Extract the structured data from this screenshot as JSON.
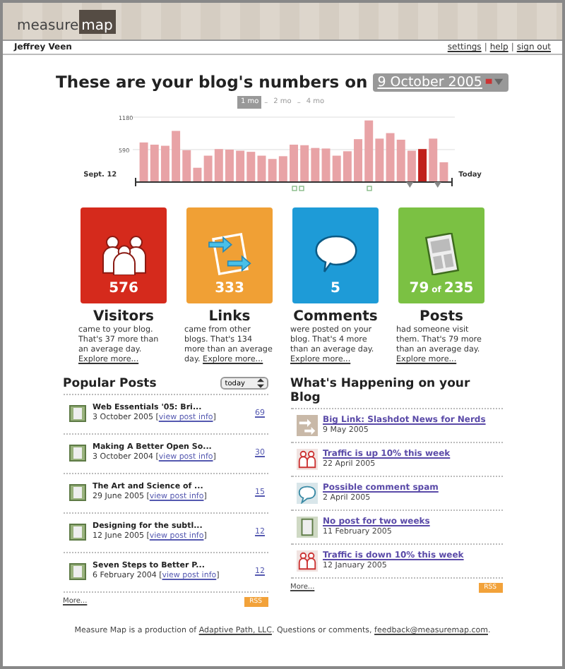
{
  "header": {
    "logo_left": "measure",
    "logo_right": "map"
  },
  "user_bar": {
    "user": "Jeffrey Veen",
    "links": [
      "settings",
      "help",
      "sign out"
    ],
    "separator": "|"
  },
  "headline": {
    "text": "These are your blog's numbers on",
    "date": "9 October 2005"
  },
  "ranges": {
    "separator": "–",
    "items": [
      {
        "label": "1 mo",
        "selected": true
      },
      {
        "label": "2 mo",
        "selected": false
      },
      {
        "label": "4 mo",
        "selected": false
      }
    ]
  },
  "chart": {
    "start_label": "Sept. 12",
    "end_label": "Today",
    "chart_data": {
      "type": "bar",
      "series": [
        {
          "color": "#e8a3a6",
          "values": [
            720,
            680,
            660,
            930,
            580,
            260,
            480,
            600,
            590,
            570,
            550,
            480,
            420,
            470,
            680,
            670,
            620,
            610,
            480,
            560,
            780,
            1120,
            790,
            890,
            770,
            570,
            null,
            790,
            360
          ]
        },
        {
          "color": "#c0201c",
          "values": [
            null,
            null,
            null,
            null,
            null,
            null,
            null,
            null,
            null,
            null,
            null,
            null,
            null,
            null,
            null,
            null,
            null,
            null,
            null,
            null,
            null,
            null,
            null,
            null,
            null,
            null,
            600,
            null,
            null
          ]
        }
      ],
      "ylim": [
        0,
        1180
      ],
      "yticks": [
        590,
        1180
      ]
    }
  },
  "tiles": [
    {
      "kind": "visitors",
      "count": "576",
      "label": "Visitors",
      "text": "came to your blog. That's 37 more than an average day.",
      "link": "Explore more..."
    },
    {
      "kind": "links",
      "count": "333",
      "label": "Links",
      "text": "came from other blogs. That's 134 more than an average day.",
      "link": "Explore more..."
    },
    {
      "kind": "comments",
      "count": "5",
      "label": "Comments",
      "text": "were posted on your blog. That's 4 more than an average day.",
      "link": "Explore more..."
    },
    {
      "kind": "posts",
      "count": "79",
      "of_word": "of",
      "total": "235",
      "label": "Posts",
      "text": "had someone visit them. That's 79 more than an average day.",
      "link": "Explore more..."
    }
  ],
  "popular": {
    "title": "Popular Posts",
    "period": "today",
    "items": [
      {
        "title": "Web Essentials '05: Bri...",
        "date": "3 October 2005 [",
        "link": "view post info",
        "after": "]",
        "count": "69"
      },
      {
        "title": "Making A Better Open So...",
        "date": "3 October 2004 [",
        "link": "view post info",
        "after": "]",
        "count": "30"
      },
      {
        "title": "The Art and Science of ...",
        "date": "29 June 2005 [",
        "link": "view post info",
        "after": "]",
        "count": "15"
      },
      {
        "title": "Designing for the subtl...",
        "date": "12 June 2005 [",
        "link": "view post info",
        "after": "]",
        "count": "12"
      },
      {
        "title": "Seven Steps to Better P...",
        "date": "6 February 2004 [",
        "link": "view post info",
        "after": "]",
        "count": "12"
      }
    ],
    "more": "More...",
    "rss": "RSS"
  },
  "happening": {
    "title": "What's Happening on your Blog",
    "items": [
      {
        "kind": "link",
        "title": "**Big Link:** Slashdot News for Nerds",
        "date": "9 May 2005"
      },
      {
        "kind": "visitors",
        "title": "Traffic is up 10% this week",
        "date": "22 April 2005"
      },
      {
        "kind": "comments",
        "title": "Possible comment spam",
        "date": "2 April 2005"
      },
      {
        "kind": "posts",
        "title": "No post for two weeks",
        "date": "11 February 2005"
      },
      {
        "kind": "visitors",
        "title": "Traffic is down 10% this week",
        "date": "12 January 2005"
      }
    ],
    "more": "More...",
    "rss": "RSS"
  },
  "footer": {
    "before": "Measure Map is a production of",
    "link1": "Adaptive Path, LLC",
    "middle": ". Questions or comments,",
    "link2": "feedback@measuremap.com",
    "after": "."
  }
}
